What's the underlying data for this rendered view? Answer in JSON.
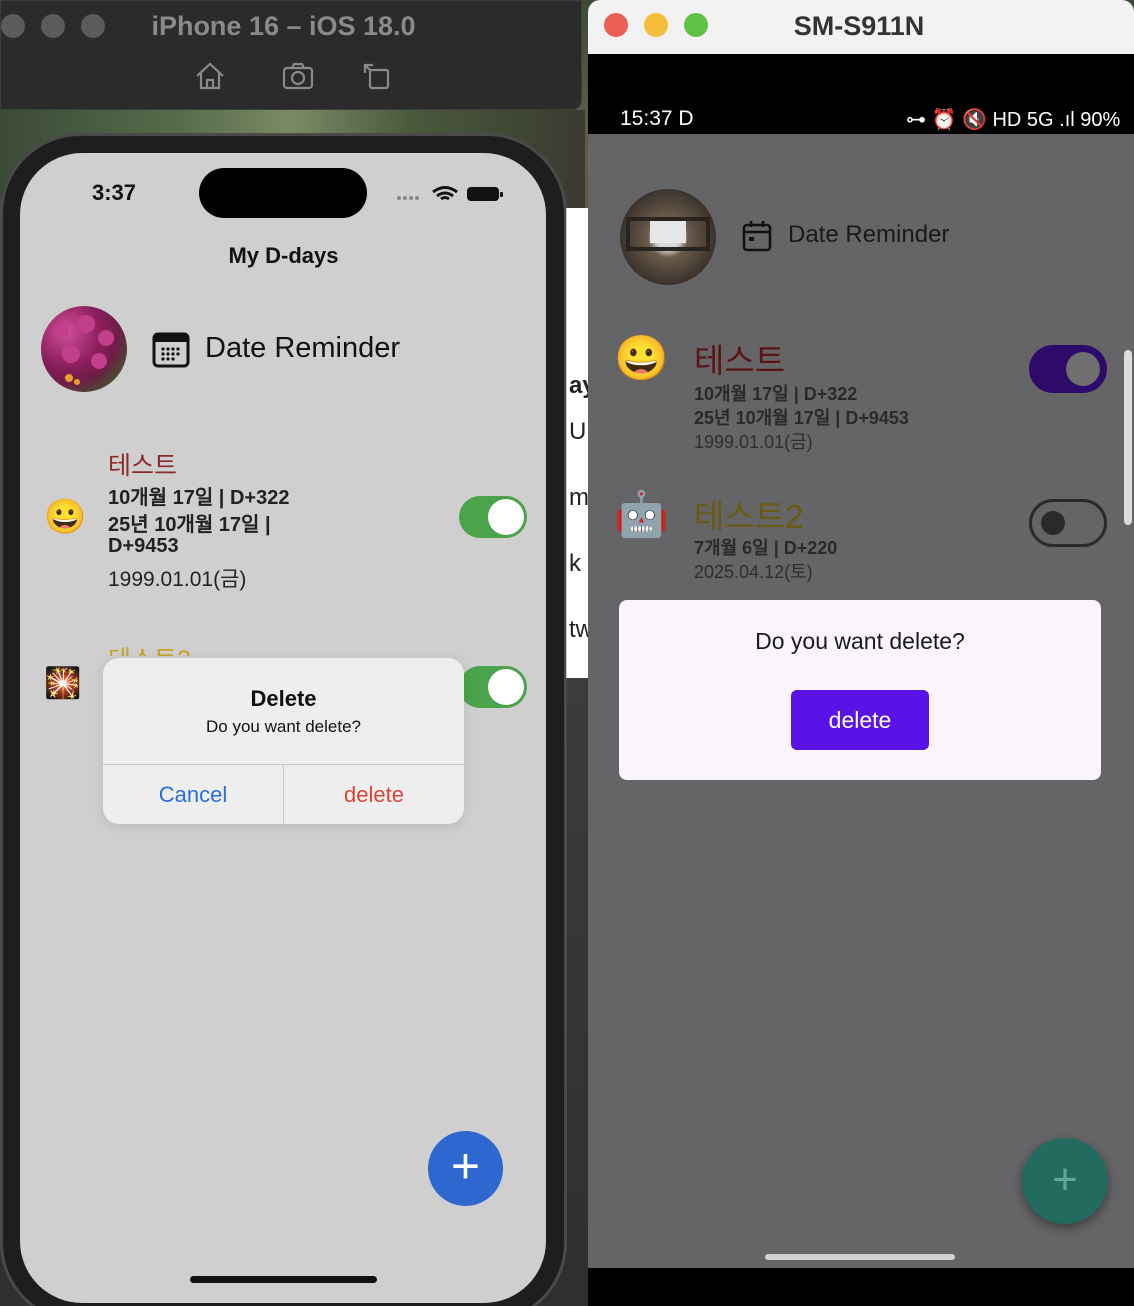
{
  "ios_window": {
    "title": "iPhone 16 – iOS 18.0",
    "status_time": "3:37",
    "screen_title": "My D-days",
    "app_name": "Date Reminder",
    "items": [
      {
        "title": "테스트",
        "line1": "10개월 17일 | D+322",
        "line2": "25년 10개월 17일 |",
        "line3": "D+9453",
        "date": "1999.01.01(금)",
        "emoji": "😀",
        "toggle_on": true
      },
      {
        "title": "테스트2",
        "emoji": "🎇",
        "toggle_on": true
      }
    ],
    "alert": {
      "title": "Delete",
      "message": "Do you want delete?",
      "cancel_label": "Cancel",
      "delete_label": "delete"
    },
    "fab_label": "+"
  },
  "middle_strip": {
    "texts": [
      "ay",
      "U",
      "m",
      "k",
      "tw"
    ]
  },
  "android_window": {
    "title": "SM-S911N",
    "status_time": "15:37 D",
    "status_right": "⊶ ⏰ 🔇 HD 5G .ıl 90%",
    "app_name": "Date Reminder",
    "items": [
      {
        "title": "테스트",
        "line1": "10개월 17일 | D+322",
        "line2": "25년 10개월 17일 | D+9453",
        "date": "1999.01.01(금)",
        "emoji": "😀",
        "toggle_on": true
      },
      {
        "title": "테스트2",
        "line1": "7개월 6일 | D+220",
        "date": "2025.04.12(토)",
        "emoji": "🤖",
        "toggle_on": false
      }
    ],
    "dialog": {
      "message": "Do you want delete?",
      "delete_label": "delete"
    },
    "fab_label": "+"
  },
  "colors": {
    "ios_toggle": "#4ba34c",
    "ios_fab": "#2d67cf",
    "android_accent": "#5a12e6",
    "android_fab": "#236a5f"
  }
}
